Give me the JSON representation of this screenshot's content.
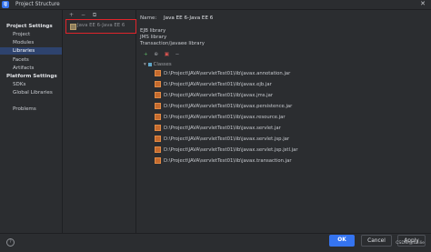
{
  "window": {
    "title": "Project Structure",
    "app_icon": "intellij-icon",
    "close_glyph": "✕"
  },
  "nav": {
    "back": "←",
    "forward": "→",
    "section_project_settings": "Project Settings",
    "project": "Project",
    "modules": "Modules",
    "libraries": "Libraries",
    "facets": "Facets",
    "artifacts": "Artifacts",
    "section_platform_settings": "Platform Settings",
    "sdks": "SDKs",
    "global_libraries": "Global Libraries",
    "problems": "Problems"
  },
  "lib_toolbar": {
    "add": "+",
    "remove": "−",
    "copy": "⧉"
  },
  "library_list": [
    {
      "label": "Java EE 6-Java EE 6"
    }
  ],
  "details": {
    "name_label": "Name:",
    "name_value": "Java EE 6-Java EE 6",
    "lines": [
      "EJB library",
      "JMS library",
      "Transaction/javaee library"
    ]
  },
  "classes_toolbar": {
    "add": "+",
    "add_attached": "⊕",
    "special": "▣",
    "remove": "−"
  },
  "classes": {
    "header": "Classes",
    "jars": [
      "D:\\Project\\JAVA\\servletTest01\\lib\\javax.annotation.jar",
      "D:\\Project\\JAVA\\servletTest01\\lib\\javax.ejb.jar",
      "D:\\Project\\JAVA\\servletTest01\\lib\\javax.jms.jar",
      "D:\\Project\\JAVA\\servletTest01\\lib\\javax.persistence.jar",
      "D:\\Project\\JAVA\\servletTest01\\lib\\javax.resource.jar",
      "D:\\Project\\JAVA\\servletTest01\\lib\\javax.servlet.jar",
      "D:\\Project\\JAVA\\servletTest01\\lib\\javax.servlet.jsp.jar",
      "D:\\Project\\JAVA\\servletTest01\\lib\\javax.servlet.jsp.jstl.jar",
      "D:\\Project\\JAVA\\servletTest01\\lib\\javax.transaction.jar"
    ]
  },
  "footer": {
    "help": "?",
    "ok": "OK",
    "cancel": "Cancel",
    "apply": "Apply",
    "watermark": "CSDN @tuiilie"
  },
  "colors": {
    "accent": "#3574f0",
    "selection": "#2e436e",
    "highlight_box": "#e0242b"
  }
}
